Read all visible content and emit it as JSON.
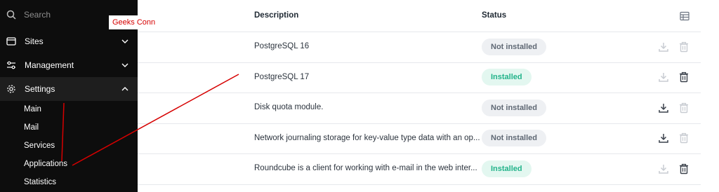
{
  "search": {
    "placeholder": "Search",
    "icon": "search-icon"
  },
  "sidebar": {
    "items": [
      {
        "label": "Sites",
        "icon": "browser-window-icon",
        "state": "collapsed"
      },
      {
        "label": "Management",
        "icon": "sliders-icon",
        "state": "collapsed"
      },
      {
        "label": "Settings",
        "icon": "gear-icon",
        "state": "expanded"
      }
    ],
    "settings_children": [
      "Main",
      "Mail",
      "Services",
      "Applications",
      "Statistics"
    ]
  },
  "annotation": {
    "text": "Geeks Conn",
    "color": "#d60000"
  },
  "table": {
    "headers": {
      "description": "Description",
      "status": "Status"
    },
    "rows": [
      {
        "description": "PostgreSQL 16",
        "status": "Not installed",
        "install_enabled": false,
        "delete_enabled": false
      },
      {
        "description": "PostgreSQL 17",
        "status": "Installed",
        "install_enabled": false,
        "delete_enabled": true
      },
      {
        "description": "Disk quota module.",
        "status": "Not installed",
        "install_enabled": true,
        "delete_enabled": false
      },
      {
        "description": "Network journaling storage for key-value type data with an op...",
        "status": "Not installed",
        "install_enabled": true,
        "delete_enabled": false
      },
      {
        "description": "Roundcube is a client for working with e-mail in the web inter...",
        "status": "Installed",
        "install_enabled": false,
        "delete_enabled": true
      }
    ]
  },
  "colors": {
    "sidebar_bg": "#0d0d0d",
    "installed_text": "#22b38a",
    "installed_bg": "#e3f7f0",
    "not_installed_bg": "#eef0f3",
    "annotation_line": "#d60000"
  }
}
